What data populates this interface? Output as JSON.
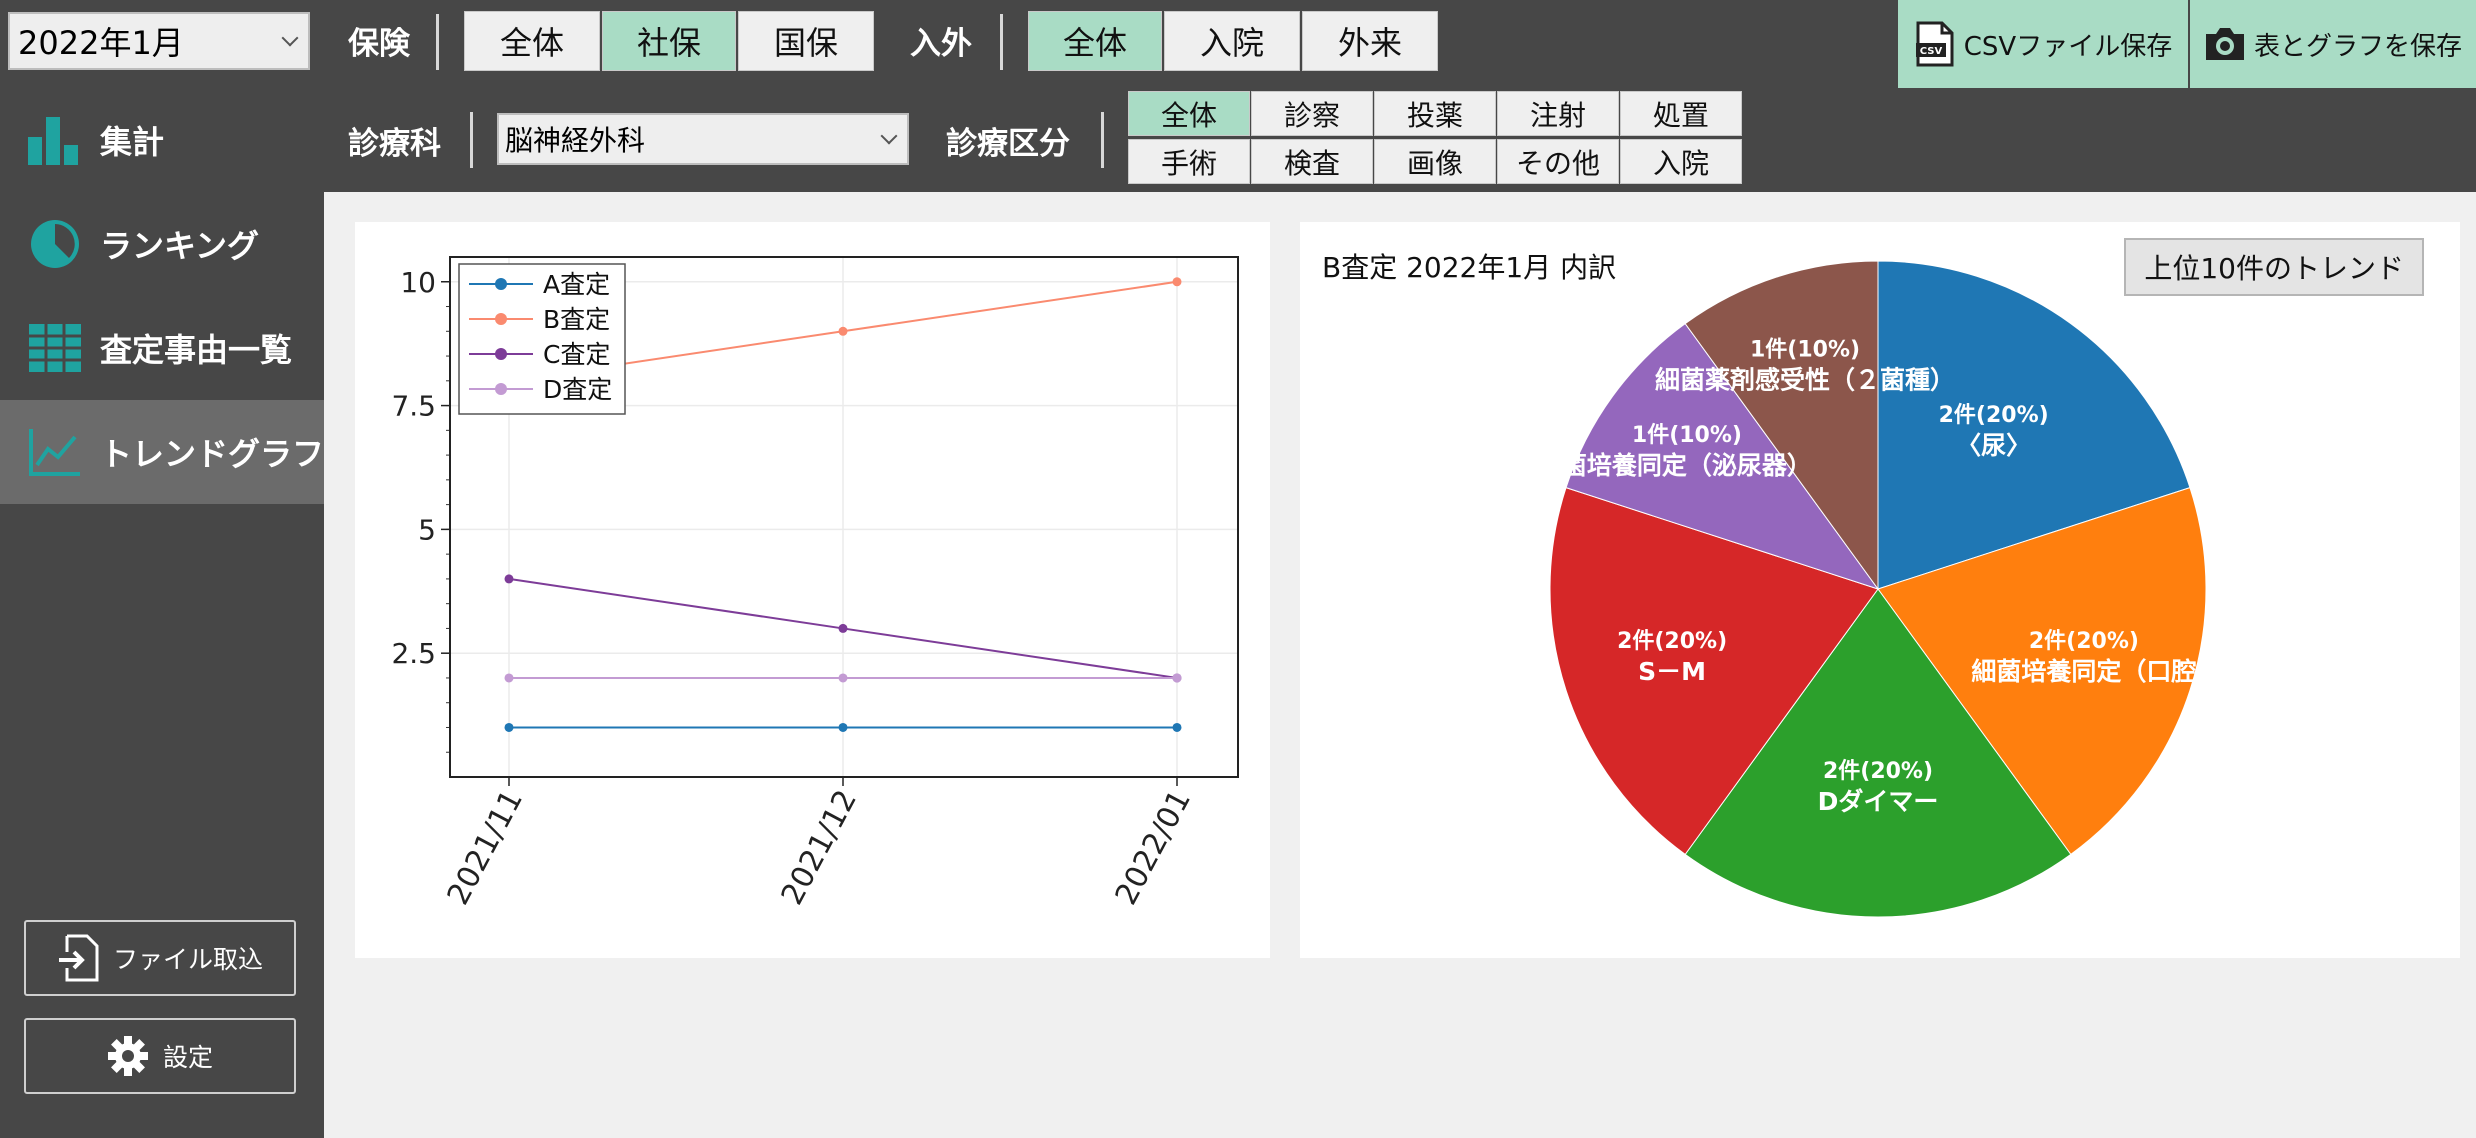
{
  "filters": {
    "month": "2022年1月",
    "insurance": {
      "label": "保険",
      "options": [
        "全体",
        "社保",
        "国保"
      ],
      "selected": [
        false,
        true,
        false
      ]
    },
    "inout": {
      "label": "入外",
      "options": [
        "全体",
        "入院",
        "外来"
      ],
      "selected": [
        true,
        false,
        false
      ]
    },
    "department": {
      "label": "診療科",
      "value": "脳神経外科"
    },
    "category": {
      "label": "診療区分",
      "row1": [
        "全体",
        "診察",
        "投薬",
        "注射",
        "処置"
      ],
      "row2": [
        "手術",
        "検査",
        "画像",
        "その他",
        "入院"
      ],
      "selected": "全体"
    }
  },
  "toolbar": {
    "csv_label": "CSVファイル保存",
    "save_label": "表とグラフを保存",
    "csv_badge": "CSV"
  },
  "sidebar": {
    "items": [
      {
        "label": "集計",
        "icon": "bar-chart-icon"
      },
      {
        "label": "ランキング",
        "icon": "pie-chart-icon"
      },
      {
        "label": "査定事由一覧",
        "icon": "table-icon"
      },
      {
        "label": "トレンドグラフ",
        "icon": "trend-chart-icon",
        "active": true
      }
    ],
    "import_label": "ファイル取込",
    "settings_label": "設定"
  },
  "colors": {
    "accent": "#a9dcc5",
    "icon_teal": "#1fa3a0",
    "dark": "#474747"
  },
  "chart_data": [
    {
      "type": "line",
      "x": [
        "2021/11",
        "2021/12",
        "2022/01"
      ],
      "yticks": [
        "2.5",
        "5",
        "7.5",
        "10"
      ],
      "ylim": [
        0,
        10.5
      ],
      "grid": true,
      "legend": "top-left",
      "series": [
        {
          "name": "A査定",
          "values": [
            1,
            1,
            1
          ],
          "color": "#1f77b4"
        },
        {
          "name": "B査定",
          "values": [
            8,
            9,
            10
          ],
          "color": "#fa8a6f"
        },
        {
          "name": "C査定",
          "values": [
            4,
            3,
            2
          ],
          "color": "#7d3c98"
        },
        {
          "name": "D査定",
          "values": [
            2,
            2,
            2
          ],
          "color": "#c39bd3"
        }
      ]
    },
    {
      "type": "pie",
      "title": "B査定 2022年1月 内訳",
      "button": "上位10件のトレンド",
      "slices": [
        {
          "label": "〈尿〉",
          "count": "2件(20%)",
          "value": 2,
          "color": "#1f77b4"
        },
        {
          "label": "細菌培養同定（口腔",
          "count": "2件(20%)",
          "value": 2,
          "color": "#ff7f0e"
        },
        {
          "label": "Dダイマー",
          "count": "2件(20%)",
          "value": 2,
          "color": "#2ca02c"
        },
        {
          "label": "S－M",
          "count": "2件(20%)",
          "value": 2,
          "color": "#d62728"
        },
        {
          "label": "菌培養同定（泌尿器）",
          "count": "1件(10%)",
          "value": 1,
          "color": "#9467bd"
        },
        {
          "label": "細菌薬剤感受性（２菌種）",
          "count": "1件(10%)",
          "value": 1,
          "color": "#8c564b"
        }
      ]
    }
  ]
}
